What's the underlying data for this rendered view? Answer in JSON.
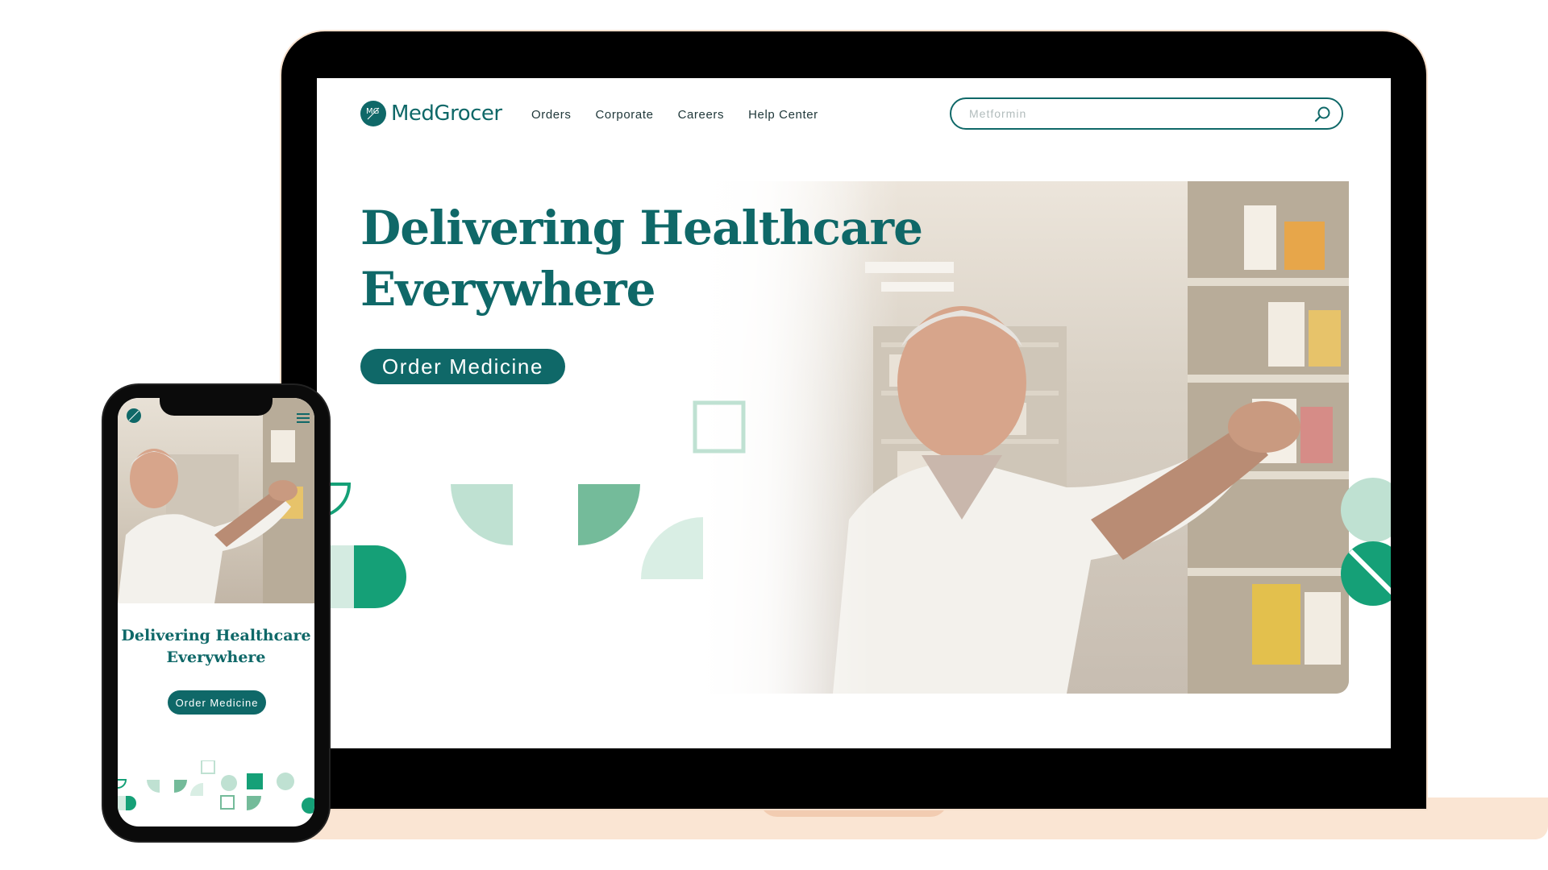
{
  "brand": {
    "name": "MedGrocer",
    "logo_monogram": "MG",
    "accent_color": "#0f6868",
    "shape_colors": [
      "#bfe1d2",
      "#74bb9a",
      "#15a077"
    ]
  },
  "nav": {
    "items": [
      "Orders",
      "Corporate",
      "Careers",
      "Help Center"
    ]
  },
  "search": {
    "placeholder": "Metformin",
    "icon": "search-icon"
  },
  "hero": {
    "title_line1": "Delivering Healthcare",
    "title_line2": "Everywhere",
    "cta_label": "Order Medicine"
  },
  "mobile": {
    "title_line1": "Delivering Healthcare",
    "title_line2": "Everywhere",
    "cta_label": "Order Medicine",
    "menu_icon": "hamburger-menu-icon"
  }
}
